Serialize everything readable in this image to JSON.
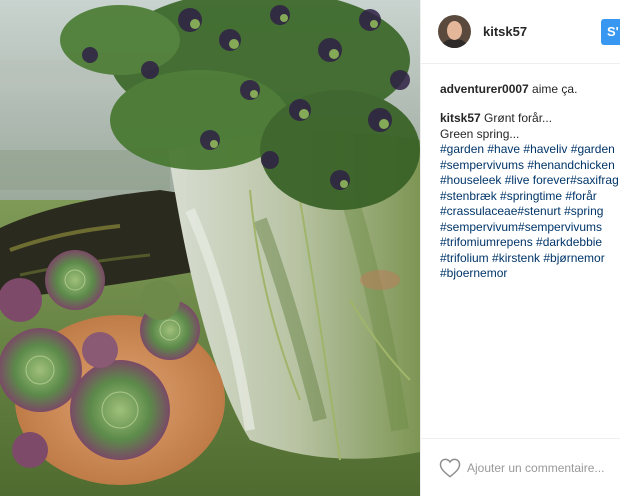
{
  "post": {
    "author": "kitsk57",
    "follow_label": "S'",
    "likes": {
      "user": "adventurer0007",
      "text": " aime ça."
    },
    "caption": {
      "first_line": "Grønt forår...",
      "second_line": "Green spring...",
      "hashtag_lines": [
        "#garden #have #haveliv #garden",
        "#sempervivums #henandchicken",
        "#houseleek #live forever#saxifrag",
        "#stenbræk #springtime #forår",
        "#crassulaceae#stenurt #spring",
        "#sempervivum#sempervivums",
        "#trifomiumrepens #darkdebbie",
        "#trifolium #kirstenk #bjørnemor",
        "#bjoernemor"
      ]
    },
    "comment": {
      "placeholder": "Ajouter un commentaire..."
    }
  },
  "icons": {
    "like": "heart-outline-icon",
    "avatar": "profile-photo"
  },
  "colors": {
    "follow_button": "#3897f0",
    "hashtag": "#003569",
    "text": "#262626",
    "placeholder": "#999999"
  }
}
